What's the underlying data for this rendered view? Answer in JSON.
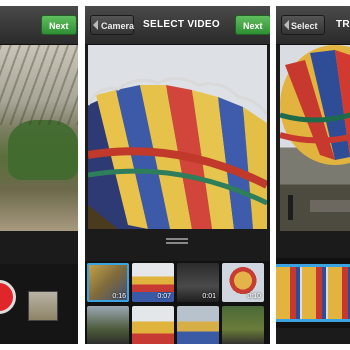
{
  "screens": {
    "left": {
      "next_label": "Next"
    },
    "center": {
      "back_label": "Camera",
      "title": "SELECT VIDEO",
      "next_label": "Next",
      "thumbnails": [
        {
          "duration": "0:16",
          "selected": true
        },
        {
          "duration": "0:07",
          "selected": false
        },
        {
          "duration": "0:01",
          "selected": false
        },
        {
          "duration": "0:10",
          "selected": false
        },
        {
          "duration": "",
          "selected": false
        },
        {
          "duration": "",
          "selected": false
        },
        {
          "duration": "",
          "selected": false
        },
        {
          "duration": "",
          "selected": false
        }
      ]
    },
    "right": {
      "back_label": "Select",
      "title": "TR"
    }
  },
  "colors": {
    "accent_green": "#3a9c3e",
    "selection_blue": "#3aa3e0",
    "record_red": "#e0262a"
  },
  "icons": [
    "record-icon",
    "drag-handle-icon",
    "back-arrow-icon"
  ]
}
